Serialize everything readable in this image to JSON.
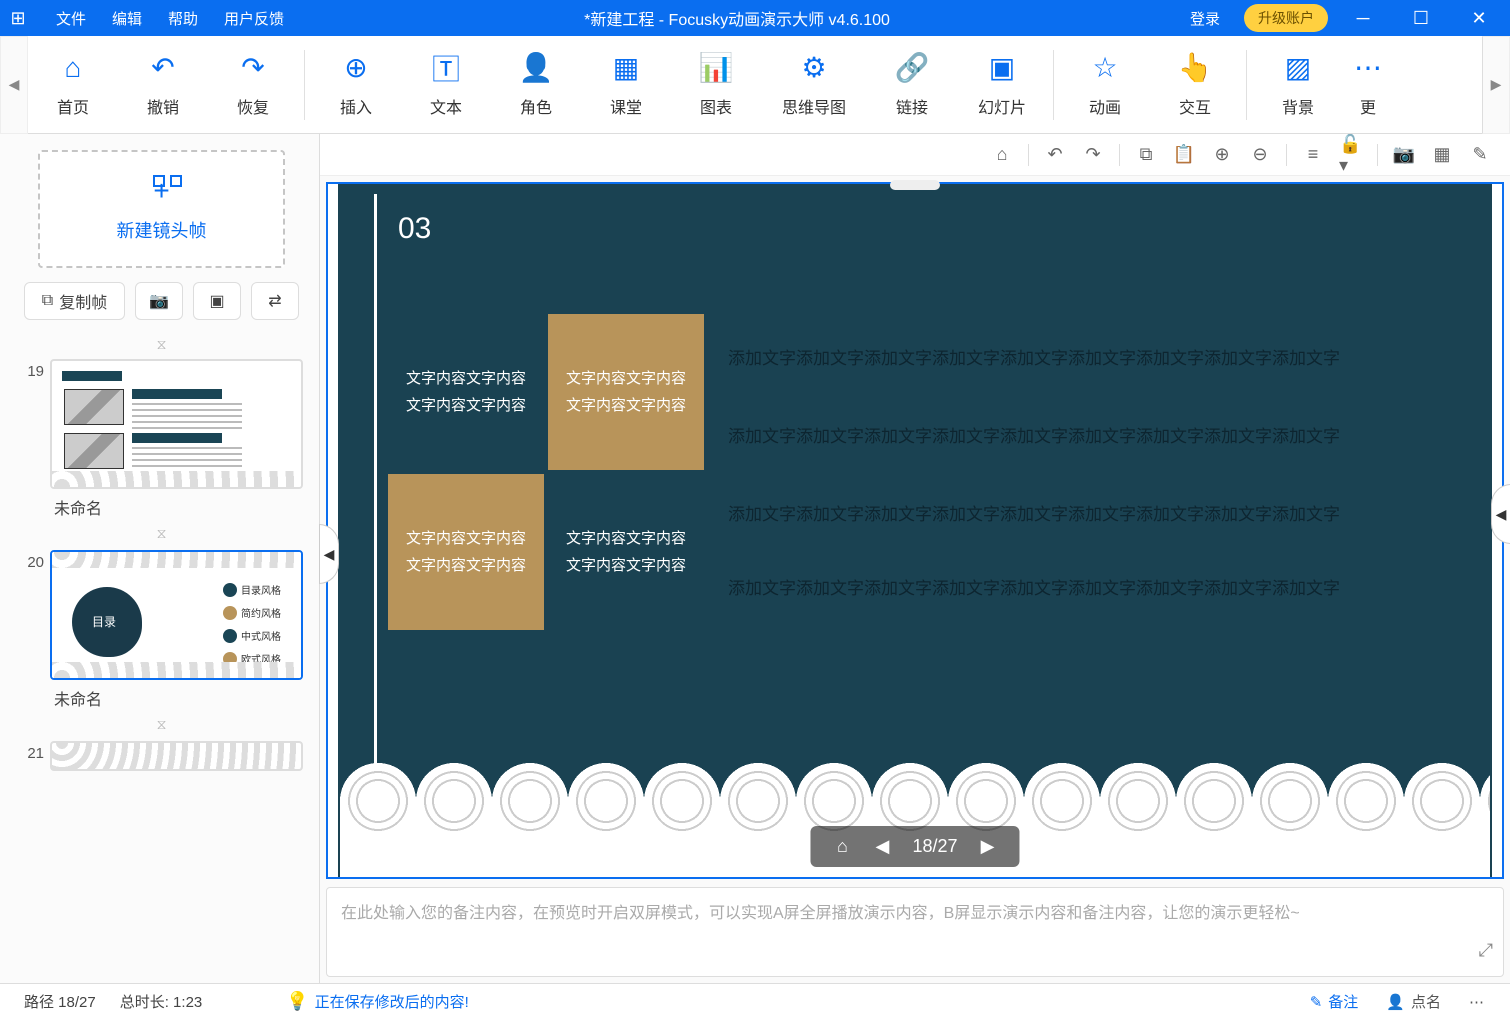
{
  "titlebar": {
    "menus": {
      "file": "文件",
      "edit": "编辑",
      "help": "帮助",
      "feedback": "用户反馈"
    },
    "title": "*新建工程 - Focusky动画演示大师  v4.6.100",
    "login": "登录",
    "upgrade": "升级账户"
  },
  "ribbon": {
    "home": "首页",
    "undo": "撤销",
    "redo": "恢复",
    "insert": "插入",
    "text": "文本",
    "role": "角色",
    "class": "课堂",
    "chart": "图表",
    "mindmap": "思维导图",
    "link": "链接",
    "slide": "幻灯片",
    "anim": "动画",
    "interact": "交互",
    "bg": "背景",
    "more": "更"
  },
  "leftpanel": {
    "newframe": "新建镜头帧",
    "copy": "复制帧",
    "thumbs": [
      {
        "num": "19",
        "label": "未命名"
      },
      {
        "num": "20",
        "label": "未命名"
      },
      {
        "num": "21",
        "label": ""
      }
    ]
  },
  "canvas": {
    "num": "03",
    "box_text_line1": "文字内容文字内容",
    "box_text_line2": "文字内容文字内容",
    "para": "添加文字添加文字添加文字添加文字添加文字添加文字添加文字添加文字添加文字",
    "nav_page": "18/27"
  },
  "notes": {
    "placeholder": "在此处输入您的备注内容，在预览时开启双屏模式，可以实现A屏全屏播放演示内容，B屏显示演示内容和备注内容，让您的演示更轻松~"
  },
  "statusbar": {
    "path": "路径  18/27",
    "duration": "总时长:  1:23",
    "saving": "正在保存修改后的内容!",
    "notes": "备注",
    "roll": "点名"
  }
}
